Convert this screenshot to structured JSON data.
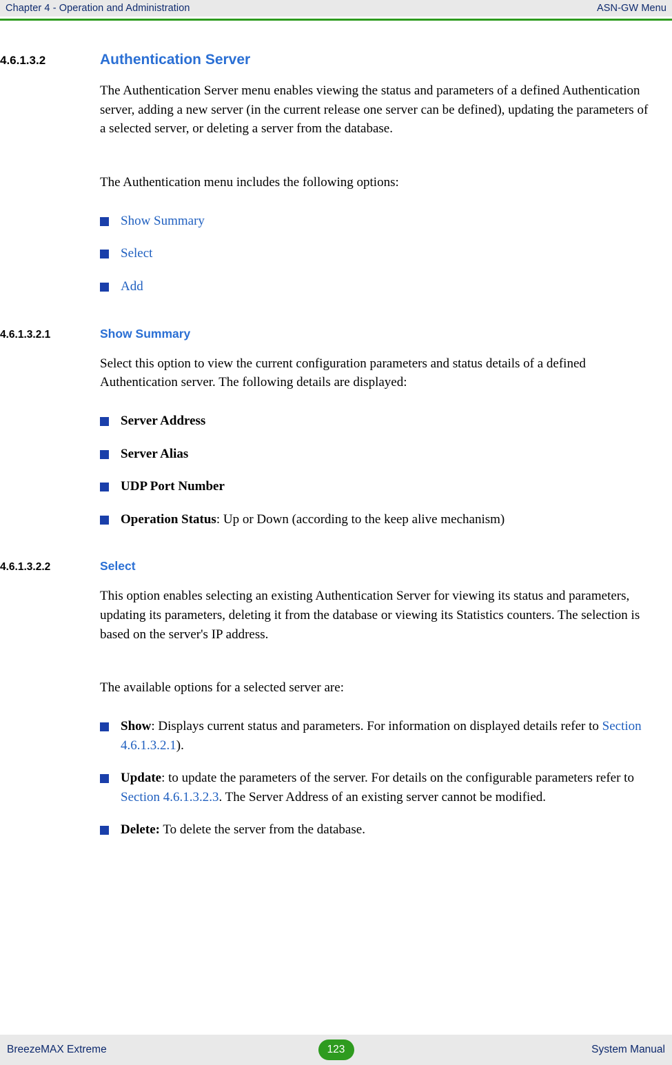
{
  "header": {
    "left": "Chapter 4 - Operation and Administration",
    "right": "ASN-GW Menu"
  },
  "footer": {
    "left": "BreezeMAX Extreme",
    "page": "123",
    "right": "System Manual"
  },
  "sections": [
    {
      "number": "4.6.1.3.2",
      "title": "Authentication Server",
      "paragraphs": [
        "The Authentication Server menu enables viewing the status and parameters of a defined Authentication server, adding a new server (in the current release one server can be defined), updating the parameters of a selected server, or deleting a server from the database.",
        "The Authentication menu includes the following options:"
      ],
      "bullets": [
        {
          "text": "Show Summary",
          "style": "link"
        },
        {
          "text": "Select",
          "style": "link"
        },
        {
          "text": "Add",
          "style": "link"
        }
      ]
    },
    {
      "number": "4.6.1.3.2.1",
      "title": "Show Summary",
      "paragraphs": [
        "Select this option to view the current configuration parameters and status details of a defined Authentication server. The following details are displayed:"
      ],
      "bullets": [
        {
          "bold": "Server Address",
          "rest": ""
        },
        {
          "bold": "Server Alias",
          "rest": ""
        },
        {
          "bold": "UDP Port Number",
          "rest": ""
        },
        {
          "bold": "Operation Status",
          "rest": ": Up or Down (according to the keep alive mechanism)"
        }
      ]
    },
    {
      "number": "4.6.1.3.2.2",
      "title": "Select",
      "paragraphs": [
        "This option enables selecting an existing Authentication Server for viewing its status and parameters, updating its parameters, deleting it from the database or viewing its Statistics counters. The selection is based on the server's IP address.",
        "The available options for a selected server are:"
      ],
      "bullets": [
        {
          "bold": "Show",
          "part1": ": Displays current status and parameters. For information on displayed details refer to ",
          "xref": "Section 4.6.1.3.2.1",
          "part2": ")."
        },
        {
          "bold": "Update",
          "part1": ": to update the parameters of the server. For details on the configurable parameters refer to ",
          "xref": "Section 4.6.1.3.2.3",
          "part2": ". The Server Address of an existing server cannot be modified."
        },
        {
          "bold": "Delete:",
          "part1": " To delete the server from the database.",
          "xref": "",
          "part2": ""
        }
      ]
    }
  ]
}
